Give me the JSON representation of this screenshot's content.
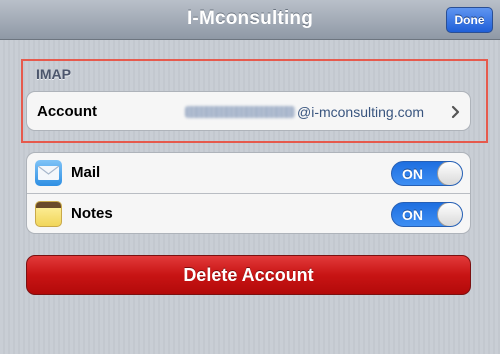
{
  "navbar": {
    "title": "I-Mconsulting",
    "done_label": "Done"
  },
  "section": {
    "header": "IMAP"
  },
  "account": {
    "label": "Account",
    "value_visible": "@i-mconsulting.com",
    "chevron_icon": "chevron-right-icon"
  },
  "apps": [
    {
      "label": "Mail",
      "icon": "mail-icon",
      "toggle": "ON"
    },
    {
      "label": "Notes",
      "icon": "notes-icon",
      "toggle": "ON"
    }
  ],
  "delete_button": {
    "label": "Delete Account"
  },
  "colors": {
    "navbar_top": "#b9c0c9",
    "done_blue": "#1f5fd8",
    "toggle_blue": "#1e6fe0",
    "delete_red": "#c81414",
    "highlight": "#e65a4d"
  }
}
